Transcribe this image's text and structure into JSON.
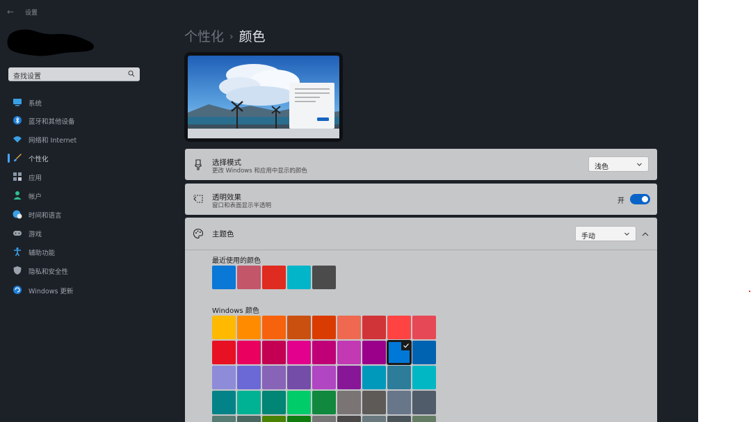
{
  "app": {
    "title": "设置"
  },
  "search": {
    "placeholder": "查找设置"
  },
  "nav": {
    "items": [
      {
        "label": "系统",
        "icon": "monitor-icon"
      },
      {
        "label": "蓝牙和其他设备",
        "icon": "bluetooth-icon"
      },
      {
        "label": "网络和 Internet",
        "icon": "wifi-icon"
      },
      {
        "label": "个性化",
        "icon": "brush-icon",
        "active": true
      },
      {
        "label": "应用",
        "icon": "apps-icon"
      },
      {
        "label": "帐户",
        "icon": "person-icon"
      },
      {
        "label": "时间和语言",
        "icon": "globe-clock-icon"
      },
      {
        "label": "游戏",
        "icon": "gamepad-icon"
      },
      {
        "label": "辅助功能",
        "icon": "accessibility-icon"
      },
      {
        "label": "隐私和安全性",
        "icon": "shield-icon"
      },
      {
        "label": "Windows 更新",
        "icon": "update-icon"
      }
    ]
  },
  "breadcrumb": {
    "parent": "个性化",
    "separator": "›",
    "current": "颜色"
  },
  "mode": {
    "title": "选择模式",
    "subtitle": "更改 Windows 和应用中显示的颜色",
    "value": "浅色"
  },
  "transparency": {
    "title": "透明效果",
    "subtitle": "窗口和表面显示半透明",
    "state_label": "开",
    "on": true
  },
  "accent": {
    "title": "主题色",
    "value": "手动",
    "recent_label": "最近使用的颜色",
    "recent_colors": [
      "#0a78d7",
      "#c4566a",
      "#e02b20",
      "#03b5c9",
      "#4b4b4b"
    ],
    "windows_label": "Windows 颜色",
    "windows_colors": [
      [
        "#ffb900",
        "#ff8c00",
        "#f7630c",
        "#ca5010",
        "#da3b01",
        "#ef6950",
        "#d13438",
        "#ff4343",
        "#e74856"
      ],
      [
        "#e81123",
        "#ea005e",
        "#c30052",
        "#e3008c",
        "#bf0077",
        "#c239b3",
        "#9a0089",
        "#0078d7",
        "#0063b1"
      ],
      [
        "#8e8cd8",
        "#6b69d6",
        "#8764b8",
        "#744da9",
        "#b146c2",
        "#881798",
        "#0099bc",
        "#2d7d9a",
        "#00b7c3"
      ],
      [
        "#038387",
        "#00b294",
        "#018574",
        "#00cc6a",
        "#10893e",
        "#7a7574",
        "#5d5a58",
        "#68768a",
        "#515c6b"
      ],
      [
        "#567c73",
        "#486860",
        "#498205",
        "#107c10",
        "#767676",
        "#4c4a48",
        "#69797e",
        "#4a5459",
        "#647c64"
      ]
    ],
    "selected": {
      "row": 1,
      "col": 7
    }
  }
}
